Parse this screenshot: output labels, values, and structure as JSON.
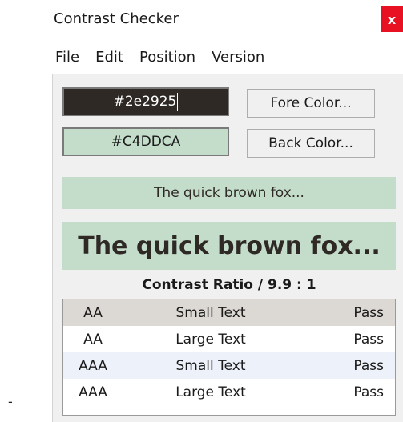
{
  "window": {
    "title": "Contrast Checker",
    "close_label": "x"
  },
  "menu": {
    "items": [
      "File",
      "Edit",
      "Position",
      "Version"
    ]
  },
  "controls": {
    "fore_value": "#2e2925",
    "back_value": "#C4DDCA",
    "fore_button": "Fore Color...",
    "back_button": "Back Color..."
  },
  "colors": {
    "fore": "#2e2925",
    "back": "#c4ddca",
    "close_button": "#e81123"
  },
  "preview": {
    "small_text": "The quick brown fox...",
    "large_text": "The quick brown fox..."
  },
  "ratio_text": "Contrast Ratio / 9.9 : 1",
  "results": [
    {
      "level": "AA",
      "type": "Small Text",
      "result": "Pass"
    },
    {
      "level": "AA",
      "type": "Large Text",
      "result": "Pass"
    },
    {
      "level": "AAA",
      "type": "Small Text",
      "result": "Pass"
    },
    {
      "level": "AAA",
      "type": "Large Text",
      "result": "Pass"
    }
  ],
  "stray_text": "-"
}
